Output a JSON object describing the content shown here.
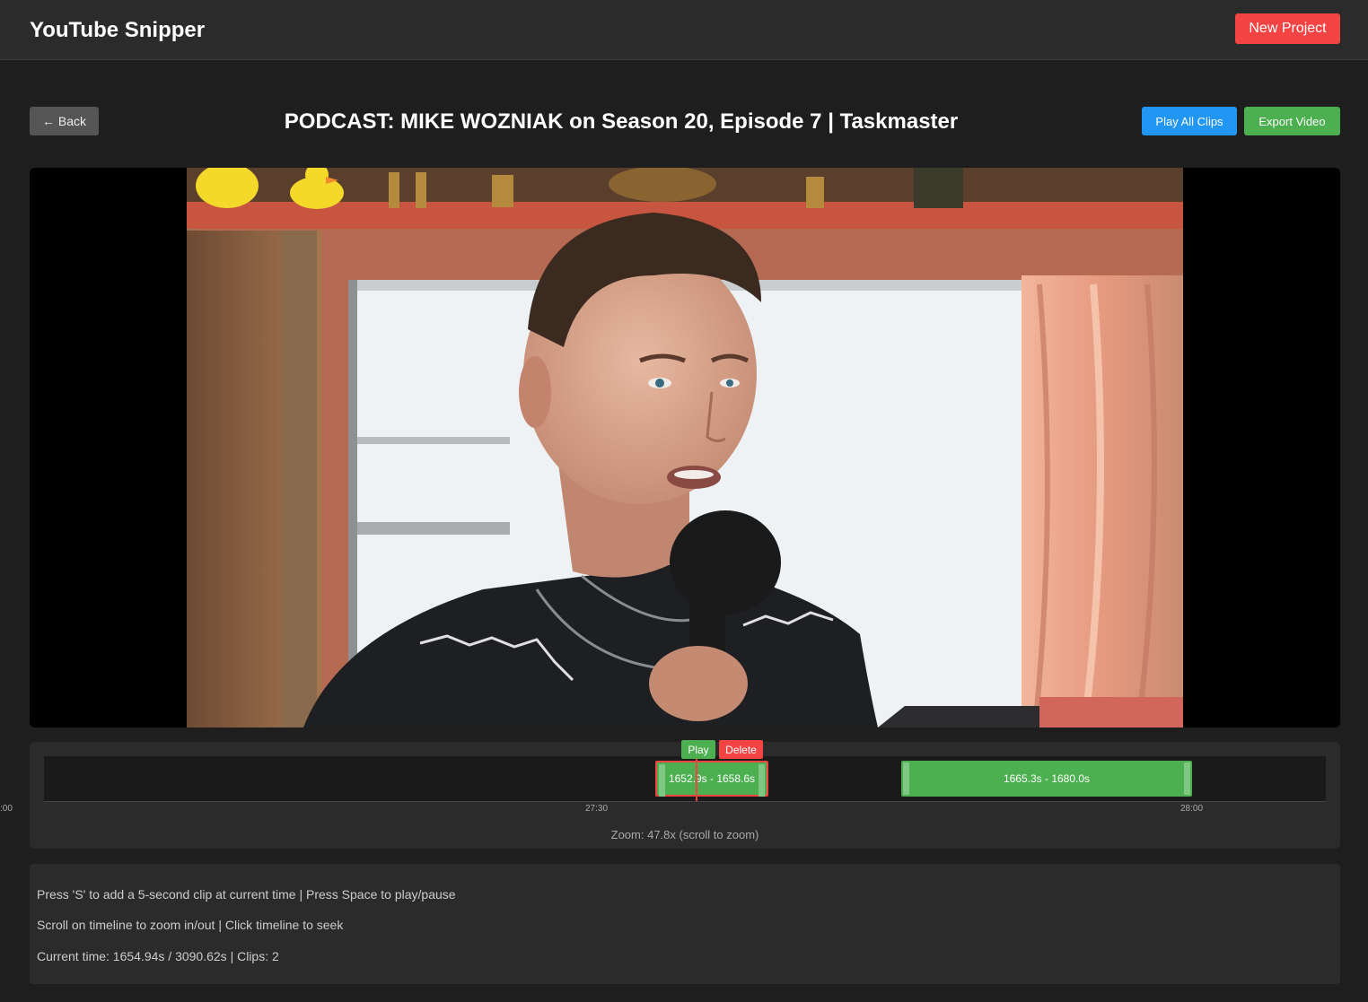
{
  "app": {
    "title": "YouTube Snipper",
    "new_project_label": "New Project"
  },
  "header": {
    "back_label": "← Back",
    "video_title": "PODCAST: MIKE WOZNIAK on Season 20, Episode 7 | Taskmaster",
    "play_all_label": "Play All Clips",
    "export_label": "Export Video"
  },
  "timeline": {
    "clips": [
      {
        "label": "1652.9s - 1658.6s",
        "selected": true
      },
      {
        "label": "1665.3s - 1680.0s",
        "selected": false
      }
    ],
    "clip_actions": {
      "play_label": "Play",
      "delete_label": "Delete"
    },
    "ticks": [
      ":00",
      "27:30",
      "28:00"
    ],
    "zoom_text": "Zoom: 47.8x (scroll to zoom)"
  },
  "help": {
    "line1": "Press 'S' to add a 5-second clip at current time | Press Space to play/pause",
    "line2": "Scroll on timeline to zoom in/out | Click timeline to seek",
    "line3": "Current time: 1654.94s / 3090.62s | Clips: 2"
  },
  "colors": {
    "accent_red": "#f44343",
    "accent_blue": "#2196f3",
    "accent_green": "#4caf50",
    "background": "#1e1e1e"
  }
}
